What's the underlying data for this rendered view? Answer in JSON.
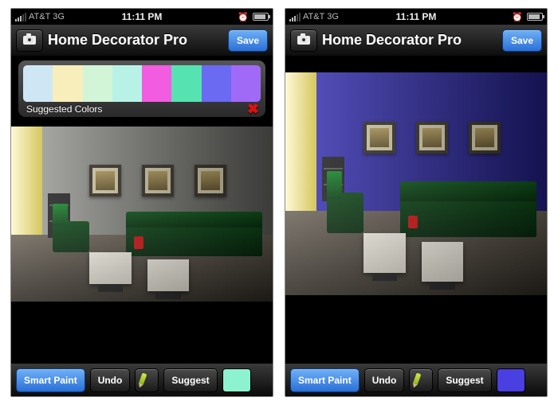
{
  "status": {
    "carrier": "AT&T",
    "network": "3G",
    "time": "11:11 PM"
  },
  "nav": {
    "title": "Home Decorator Pro",
    "save": "Save"
  },
  "palette": {
    "label": "Suggested Colors",
    "colors": [
      "#cfe6f5",
      "#f7eebc",
      "#d2f4d7",
      "#b8f2e7",
      "#f25ce0",
      "#57e3b1",
      "#6a6af2",
      "#a06af7"
    ]
  },
  "toolbar": {
    "smart": "Smart Paint",
    "undo": "Undo",
    "suggest": "Suggest"
  },
  "screens": {
    "left": {
      "wall_color": "#9fa09a",
      "current_swatch": "#8df2d0"
    },
    "right": {
      "wall_color": "#3a35b5",
      "current_swatch": "#4a3fe0"
    }
  }
}
